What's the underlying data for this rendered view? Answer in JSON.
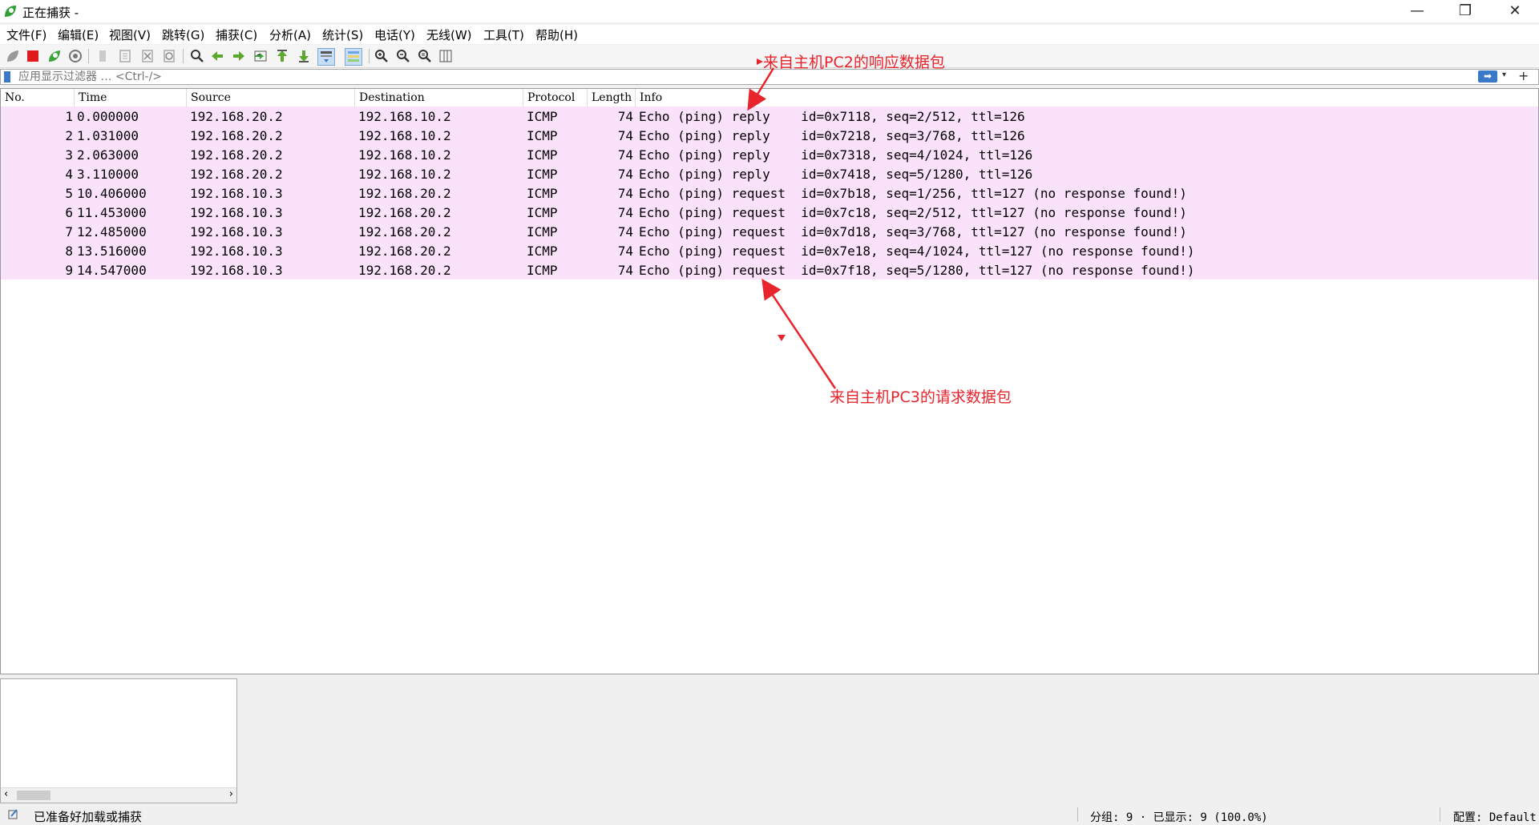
{
  "window": {
    "title": "正在捕获 -"
  },
  "menu": [
    {
      "label": "文件(F)"
    },
    {
      "label": "编辑(E)"
    },
    {
      "label": "视图(V)"
    },
    {
      "label": "跳转(G)"
    },
    {
      "label": "捕获(C)"
    },
    {
      "label": "分析(A)"
    },
    {
      "label": "统计(S)"
    },
    {
      "label": "电话(Y)"
    },
    {
      "label": "无线(W)"
    },
    {
      "label": "工具(T)"
    },
    {
      "label": "帮助(H)"
    }
  ],
  "filter": {
    "placeholder": "应用显示过滤器 … <Ctrl-/>"
  },
  "columns": [
    "No.",
    "Time",
    "Source",
    "Destination",
    "Protocol",
    "Length",
    "Info"
  ],
  "packets": [
    {
      "no": "1",
      "time": "0.000000",
      "src": "192.168.20.2",
      "dst": "192.168.10.2",
      "proto": "ICMP",
      "len": "74",
      "info": "Echo (ping) reply    id=0x7118, seq=2/512, ttl=126"
    },
    {
      "no": "2",
      "time": "1.031000",
      "src": "192.168.20.2",
      "dst": "192.168.10.2",
      "proto": "ICMP",
      "len": "74",
      "info": "Echo (ping) reply    id=0x7218, seq=3/768, ttl=126"
    },
    {
      "no": "3",
      "time": "2.063000",
      "src": "192.168.20.2",
      "dst": "192.168.10.2",
      "proto": "ICMP",
      "len": "74",
      "info": "Echo (ping) reply    id=0x7318, seq=4/1024, ttl=126"
    },
    {
      "no": "4",
      "time": "3.110000",
      "src": "192.168.20.2",
      "dst": "192.168.10.2",
      "proto": "ICMP",
      "len": "74",
      "info": "Echo (ping) reply    id=0x7418, seq=5/1280, ttl=126"
    },
    {
      "no": "5",
      "time": "10.406000",
      "src": "192.168.10.3",
      "dst": "192.168.20.2",
      "proto": "ICMP",
      "len": "74",
      "info": "Echo (ping) request  id=0x7b18, seq=1/256, ttl=127 (no response found!)"
    },
    {
      "no": "6",
      "time": "11.453000",
      "src": "192.168.10.3",
      "dst": "192.168.20.2",
      "proto": "ICMP",
      "len": "74",
      "info": "Echo (ping) request  id=0x7c18, seq=2/512, ttl=127 (no response found!)"
    },
    {
      "no": "7",
      "time": "12.485000",
      "src": "192.168.10.3",
      "dst": "192.168.20.2",
      "proto": "ICMP",
      "len": "74",
      "info": "Echo (ping) request  id=0x7d18, seq=3/768, ttl=127 (no response found!)"
    },
    {
      "no": "8",
      "time": "13.516000",
      "src": "192.168.10.3",
      "dst": "192.168.20.2",
      "proto": "ICMP",
      "len": "74",
      "info": "Echo (ping) request  id=0x7e18, seq=4/1024, ttl=127 (no response found!)"
    },
    {
      "no": "9",
      "time": "14.547000",
      "src": "192.168.10.3",
      "dst": "192.168.20.2",
      "proto": "ICMP",
      "len": "74",
      "info": "Echo (ping) request  id=0x7f18, seq=5/1280, ttl=127 (no response found!)"
    }
  ],
  "annotations": {
    "reply_note": "来自主机PC2的响应数据包",
    "request_note": "来自主机PC3的请求数据包",
    "color": "#e8242c"
  },
  "status": {
    "ready": "已准备好加载或捕获",
    "packets": "分组: 9 · 已显示: 9 (100.0%)",
    "profile": "配置: Default"
  },
  "colors": {
    "row_bg": "#fbe2fb",
    "accent": "#3a78c8"
  }
}
